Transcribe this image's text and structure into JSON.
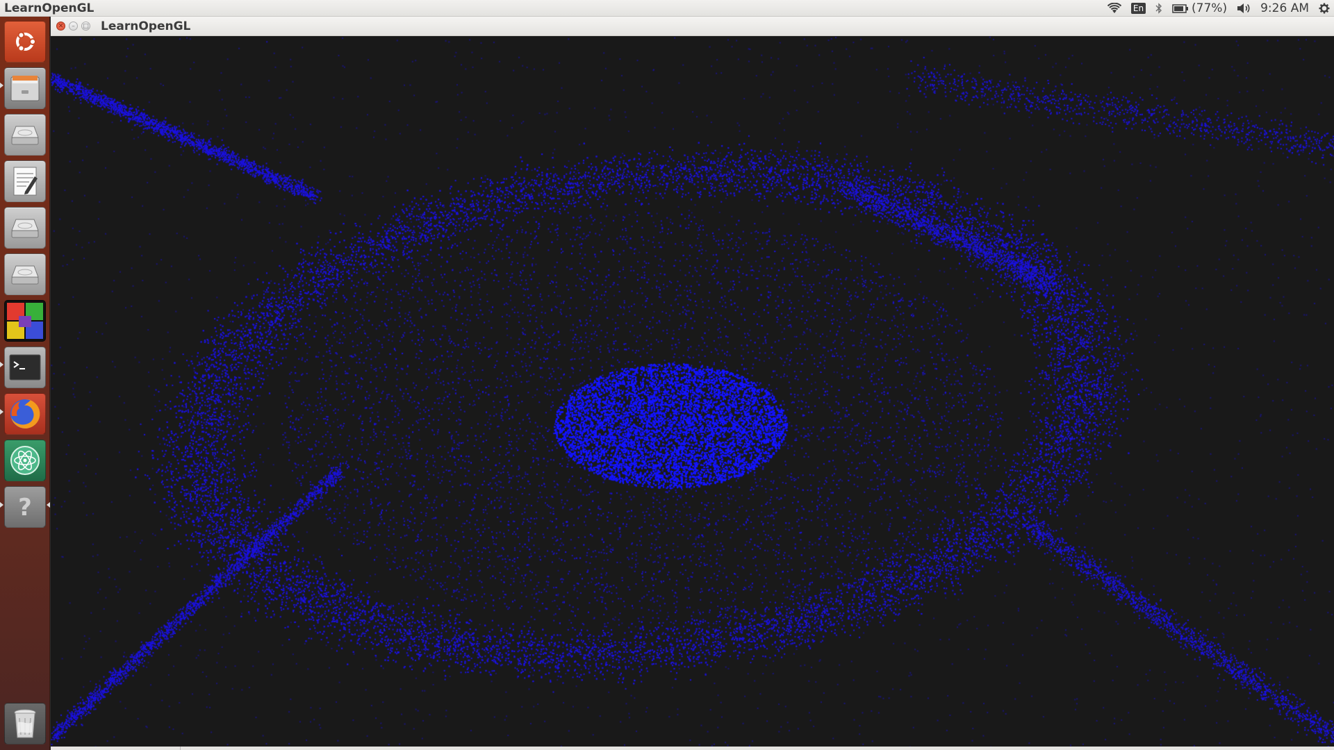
{
  "topbar": {
    "app_title": "LearnOpenGL",
    "language": "En",
    "battery": "(77%)",
    "clock": "9:26 AM"
  },
  "window": {
    "title": "LearnOpenGL"
  },
  "launcher": {
    "items": [
      {
        "icon": "ubuntu-dash-icon"
      },
      {
        "icon": "file-manager-icon"
      },
      {
        "icon": "drive-icon"
      },
      {
        "icon": "text-editor-icon"
      },
      {
        "icon": "drive-icon"
      },
      {
        "icon": "drive-icon"
      },
      {
        "icon": "color-app-icon"
      },
      {
        "icon": "terminal-icon"
      },
      {
        "icon": "firefox-icon"
      },
      {
        "icon": "atom-icon"
      },
      {
        "icon": "help-icon"
      },
      {
        "icon": "trash-icon"
      }
    ]
  },
  "scene": {
    "clear_color": "#191919",
    "particle_color": "#1a10e0",
    "core_color": "#1414ff"
  }
}
